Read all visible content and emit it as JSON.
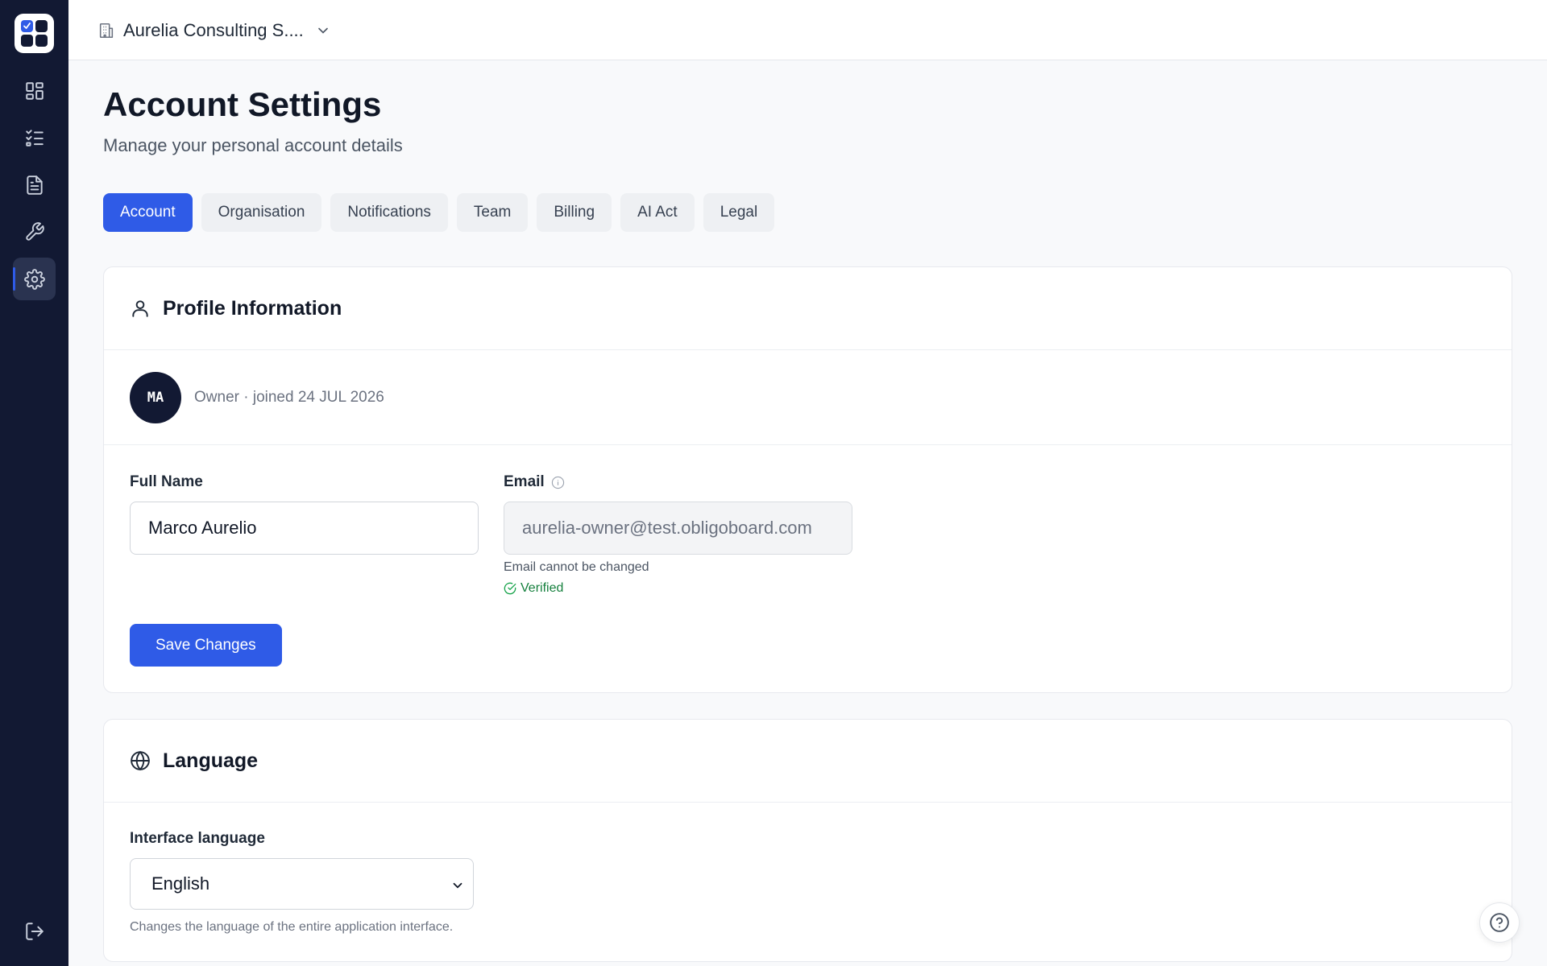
{
  "topbar": {
    "org_name": "Aurelia Consulting S....",
    "org_icon": "building-icon",
    "dropdown_icon": "chevron-down-icon"
  },
  "sidebar": {
    "items": [
      {
        "name": "dashboard",
        "icon": "grid-icon",
        "active": false
      },
      {
        "name": "tasks",
        "icon": "checklist-icon",
        "active": false
      },
      {
        "name": "documents",
        "icon": "document-icon",
        "active": false
      },
      {
        "name": "tools",
        "icon": "wrench-icon",
        "active": false
      },
      {
        "name": "settings",
        "icon": "gear-icon",
        "active": true
      }
    ],
    "logout_icon": "logout-icon"
  },
  "page": {
    "title": "Account Settings",
    "subtitle": "Manage your personal account details"
  },
  "tabs": [
    {
      "label": "Account",
      "active": true
    },
    {
      "label": "Organisation",
      "active": false
    },
    {
      "label": "Notifications",
      "active": false
    },
    {
      "label": "Team",
      "active": false
    },
    {
      "label": "Billing",
      "active": false
    },
    {
      "label": "AI Act",
      "active": false
    },
    {
      "label": "Legal",
      "active": false
    }
  ],
  "profile": {
    "heading": "Profile Information",
    "avatar_initials": "MA",
    "meta": "Owner · joined 24  JUL  2026",
    "full_name_label": "Full Name",
    "full_name_value": "Marco Aurelio",
    "email_label": "Email",
    "email_value": "aurelia-owner@test.obligoboard.com",
    "email_hint": "Email cannot be changed",
    "email_status": "Verified",
    "save_label": "Save Changes"
  },
  "language": {
    "heading": "Language",
    "field_label": "Interface language",
    "selected": "English",
    "hint": "Changes the language of the entire application interface."
  },
  "colors": {
    "sidebar_bg": "#121933",
    "accent": "#2f5be7",
    "verified": "#15803d"
  }
}
